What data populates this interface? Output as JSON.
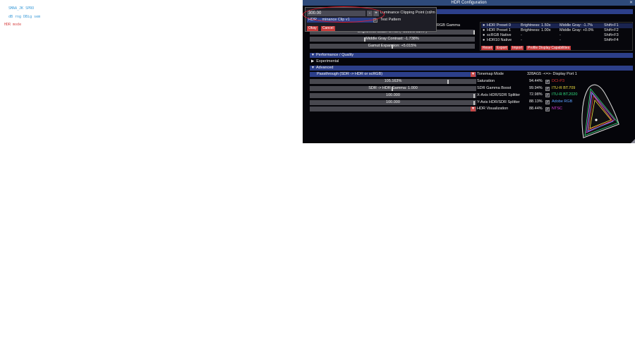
{
  "overlay": {
    "line1": "SMAA_JK  SPRO",
    "line2": "dB  rng   DBig  sem",
    "line3": "HDR  mode"
  },
  "window": {
    "title": "HDR Configuration"
  },
  "popup": {
    "value": "300.00",
    "minus": "-",
    "plus": "+",
    "label": "Luminance Clipping Point (cd/m",
    "hidden_item": "HDR ... minance Clip v1",
    "test_pattern": "Test Pattern",
    "okay": "Okay",
    "cancel": "Cancel"
  },
  "top_controls": {
    "srgb_gamma": "RGB Gamma",
    "brightness": "Brightness Scale: 3.75x  (~1001.5 cd/m²)",
    "middle_gray": "Middle Gray Contrast: -1.738%",
    "gamut_expansion": "Gamut Expansion: +5.015%"
  },
  "presets": [
    {
      "name": "HDR Preset 0",
      "brightness": "Brightness: 1.50x",
      "gray": "Middle Gray:  -1.7%",
      "key": "Shift+F1"
    },
    {
      "name": "HDR Preset 1",
      "brightness": "Brightness: 1.00x",
      "gray": "Middle Gray:  +0.0%",
      "key": "Shift+F2"
    },
    {
      "name": "scRGB Native",
      "brightness": "-",
      "gray": "-",
      "key": "Shift+F3"
    },
    {
      "name": "HDR10 Native",
      "brightness": "-",
      "gray": "-",
      "key": "Shift+F4"
    }
  ],
  "preset_buttons": {
    "reset": "Reset",
    "export": "Export",
    "import": "Import",
    "profile": "Profile Display Capabilities"
  },
  "sections": {
    "performance": "Performance / Quality",
    "experimental": "Experimental",
    "advanced": "Advanced"
  },
  "advanced": {
    "passthrough": "Passthrough (SDR -> HDR or scRGB)",
    "tonemap_label": "Tonemap Mode",
    "display": "328AG5 -<=>- Display Port 1",
    "saturation_value": "105.163%",
    "saturation_label": "Saturation",
    "gamma_value": "SDR -> HDR Gamma: 1.000",
    "gamma_label": "SDR Gamma Boost",
    "xsplit_value": "100.000",
    "xsplit_label": "X-Axis HDR/SDR Splitter",
    "ysplit_value": "100.000",
    "ysplit_label": "Y-Axis HDR/SDR Splitter",
    "vis_label": "HDR Visualization"
  },
  "gamuts": [
    {
      "pct": "94.44%",
      "name": "DCI-P3",
      "color": "#e03030"
    },
    {
      "pct": "99.94%",
      "name": "ITU-R BT.709",
      "color": "#f0e040"
    },
    {
      "pct": "72.98%",
      "name": "ITU-R BT.2020",
      "color": "#30e080"
    },
    {
      "pct": "88.13%",
      "name": "Adobe RGB",
      "color": "#5aa0ff"
    },
    {
      "pct": "88.44%",
      "name": "NTSC",
      "color": "#e040e0"
    }
  ]
}
